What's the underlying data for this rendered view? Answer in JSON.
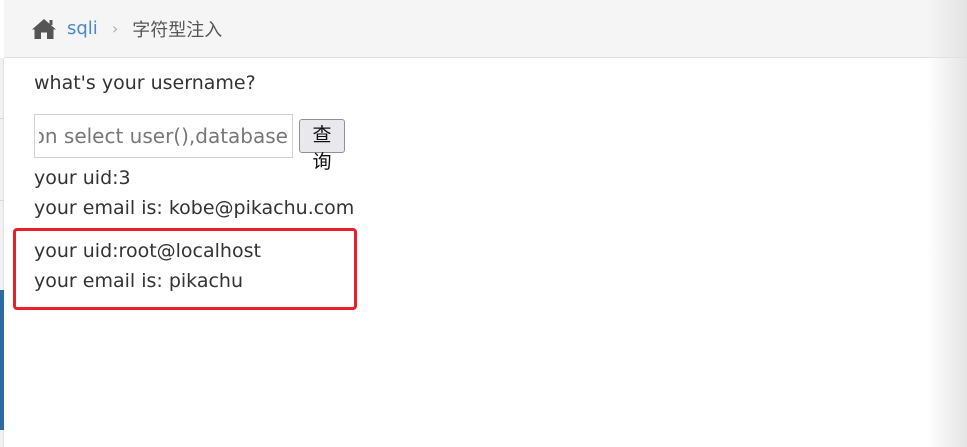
{
  "breadcrumb": {
    "home_icon": "home-icon",
    "link_label": "sqli",
    "separator": "›",
    "current_label": "字符型注入"
  },
  "form": {
    "question": "what's your username?",
    "input_value": "on select user(),database()#",
    "submit_label": "查询"
  },
  "results": [
    {
      "uid_line": "your uid:3",
      "email_line": "your email is: kobe@pikachu.com"
    },
    {
      "uid_line": "your uid:root@localhost",
      "email_line": "your email is: pikachu"
    }
  ],
  "colors": {
    "link": "#4a8ac4",
    "highlight_border": "#e8202a",
    "text": "#333333"
  }
}
